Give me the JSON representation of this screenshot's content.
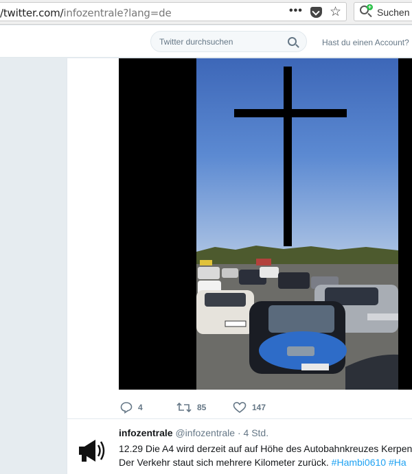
{
  "browser": {
    "url_prefix": "/twitter.com/",
    "url_path": "infozentrale?lang=de",
    "overflow_menu": "•••",
    "search_label": "Suchen"
  },
  "nav": {
    "search_placeholder": "Twitter durchsuchen",
    "account_prompt": "Hast du einen Account?"
  },
  "tweet": {
    "replies": "4",
    "retweets": "85",
    "likes": "147"
  },
  "next_tweet": {
    "name": "infozentrale",
    "handle": "@infozentrale",
    "separator": "·",
    "time": "4 Std.",
    "line1": "12.29 Die A4 wird derzeit auf auf Höhe des Autobahnkreuzes Kerpen",
    "line2_text": "Der Verkehr staut sich mehrere Kilometer zurück.",
    "hashtag1": "#Hambi0610",
    "hashtag2": "#Ha"
  },
  "colors": {
    "twitter_blue": "#1da1f2",
    "gray_text": "#657786",
    "background": "#e6ecf0"
  }
}
